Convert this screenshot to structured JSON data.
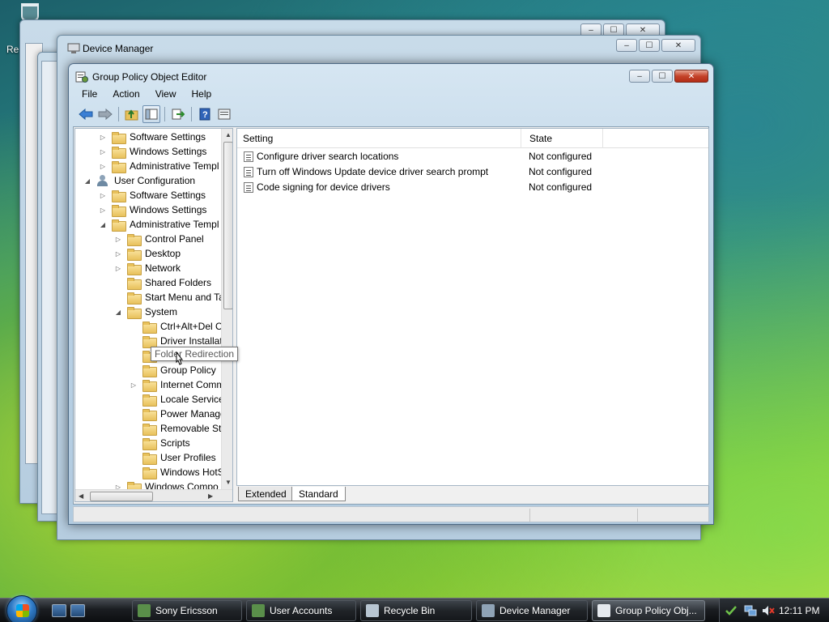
{
  "desktop": {
    "recycle_label_partial": "Re"
  },
  "bg_windows": {
    "device_manager_title": "Device Manager"
  },
  "window": {
    "title": "Group Policy Object Editor",
    "menu": [
      "File",
      "Action",
      "View",
      "Help"
    ]
  },
  "tree": {
    "items": [
      {
        "label": "Software Settings",
        "indent": 1,
        "arrow": "right",
        "icon": "folder"
      },
      {
        "label": "Windows Settings",
        "indent": 1,
        "arrow": "right",
        "icon": "folder"
      },
      {
        "label": "Administrative Templ",
        "indent": 1,
        "arrow": "right",
        "icon": "folder"
      },
      {
        "label": "User Configuration",
        "indent": 0,
        "arrow": "down",
        "icon": "user"
      },
      {
        "label": "Software Settings",
        "indent": 1,
        "arrow": "right",
        "icon": "folder"
      },
      {
        "label": "Windows Settings",
        "indent": 1,
        "arrow": "right",
        "icon": "folder"
      },
      {
        "label": "Administrative Templ",
        "indent": 1,
        "arrow": "down",
        "icon": "folder"
      },
      {
        "label": "Control Panel",
        "indent": 2,
        "arrow": "right",
        "icon": "folder"
      },
      {
        "label": "Desktop",
        "indent": 2,
        "arrow": "right",
        "icon": "folder"
      },
      {
        "label": "Network",
        "indent": 2,
        "arrow": "right",
        "icon": "folder"
      },
      {
        "label": "Shared Folders",
        "indent": 2,
        "arrow": "none",
        "icon": "folder"
      },
      {
        "label": "Start Menu and Ta",
        "indent": 2,
        "arrow": "none",
        "icon": "folder"
      },
      {
        "label": "System",
        "indent": 2,
        "arrow": "down",
        "icon": "folder"
      },
      {
        "label": "Ctrl+Alt+Del C",
        "indent": 3,
        "arrow": "none",
        "icon": "folder"
      },
      {
        "label": "Driver Installat",
        "indent": 3,
        "arrow": "none",
        "icon": "folder"
      },
      {
        "label": "Folder Redirection",
        "indent": 3,
        "arrow": "none",
        "icon": "folder"
      },
      {
        "label": "Group Policy",
        "indent": 3,
        "arrow": "none",
        "icon": "folder"
      },
      {
        "label": "Internet Comm",
        "indent": 3,
        "arrow": "right",
        "icon": "folder"
      },
      {
        "label": "Locale Service",
        "indent": 3,
        "arrow": "none",
        "icon": "folder"
      },
      {
        "label": "Power Manage",
        "indent": 3,
        "arrow": "none",
        "icon": "folder"
      },
      {
        "label": "Removable Sto",
        "indent": 3,
        "arrow": "none",
        "icon": "folder"
      },
      {
        "label": "Scripts",
        "indent": 3,
        "arrow": "none",
        "icon": "folder"
      },
      {
        "label": "User Profiles",
        "indent": 3,
        "arrow": "none",
        "icon": "folder"
      },
      {
        "label": "Windows HotS",
        "indent": 3,
        "arrow": "none",
        "icon": "folder"
      },
      {
        "label": "Windows Compo",
        "indent": 2,
        "arrow": "right",
        "icon": "folder"
      }
    ]
  },
  "list": {
    "columns": [
      "Setting",
      "State"
    ],
    "rows": [
      {
        "setting": "Configure driver search locations",
        "state": "Not configured"
      },
      {
        "setting": "Turn off Windows Update device driver search prompt",
        "state": "Not configured"
      },
      {
        "setting": "Code signing for device drivers",
        "state": "Not configured"
      }
    ]
  },
  "tabs": [
    "Extended",
    "Standard"
  ],
  "tooltip": "Folder Redirection",
  "taskbar": {
    "tasks": [
      "Sony Ericsson",
      "User Accounts",
      "Recycle Bin",
      "Device Manager",
      "Group Policy Obj..."
    ],
    "clock": "12:11 PM"
  }
}
